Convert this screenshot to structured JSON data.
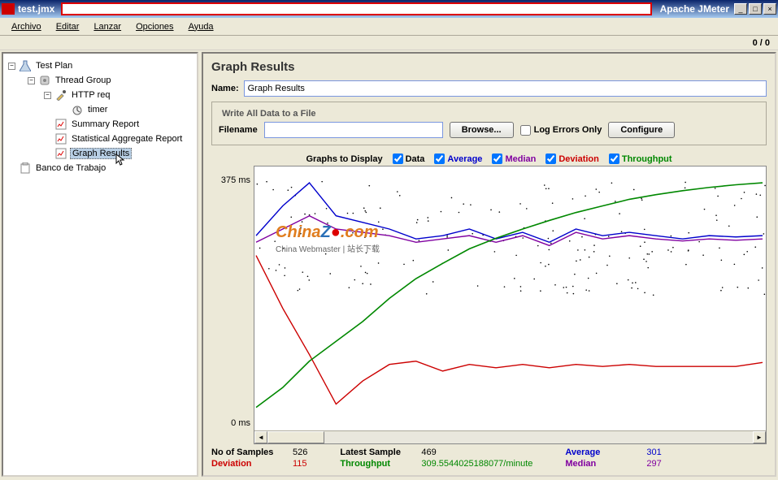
{
  "title": {
    "filename": "test.jmx",
    "app": "Apache JMeter"
  },
  "menu": {
    "archivo": "Archivo",
    "editar": "Editar",
    "lanzar": "Lanzar",
    "opciones": "Opciones",
    "ayuda": "Ayuda"
  },
  "counter": "0 / 0",
  "tree": {
    "testplan": "Test Plan",
    "threadgroup": "Thread Group",
    "httpreq": "HTTP req",
    "timer": "timer",
    "summary": "Summary Report",
    "aggregate": "Statistical Aggregate Report",
    "graph": "Graph Results",
    "workbench": "Banco de Trabajo"
  },
  "panel": {
    "heading": "Graph Results",
    "name_label": "Name:",
    "name_value": "Graph Results",
    "fieldset_title": "Write All Data to a File",
    "filename_label": "Filename",
    "filename_value": "",
    "browse": "Browse...",
    "log_errors": "Log Errors Only",
    "configure": "Configure",
    "graphs_label": "Graphs to Display",
    "opt_data": "Data",
    "opt_average": "Average",
    "opt_median": "Median",
    "opt_deviation": "Deviation",
    "opt_throughput": "Throughput"
  },
  "yaxis": {
    "top": "375 ms",
    "bottom": "0 ms"
  },
  "watermark": {
    "line1a": "China",
    "line1b": "Z",
    "line1c": ".com",
    "line2": "China Webmaster | 站长下载"
  },
  "stats": {
    "samples_label": "No of Samples",
    "samples": "526",
    "deviation_label": "Deviation",
    "deviation": "115",
    "latest_label": "Latest Sample",
    "latest": "469",
    "throughput_label": "Throughput",
    "throughput": "309.5544025188077/minute",
    "average_label": "Average",
    "average": "301",
    "median_label": "Median",
    "median": "297"
  },
  "chart_data": {
    "type": "line",
    "ylabel": "ms",
    "ylim": [
      0,
      375
    ],
    "x_samples": 526,
    "series": [
      {
        "name": "Average",
        "color": "#0000cc",
        "values": [
          290,
          335,
          370,
          320,
          310,
          300,
          285,
          290,
          300,
          285,
          295,
          280,
          300,
          290,
          295,
          290,
          285,
          290,
          288,
          290
        ]
      },
      {
        "name": "Median",
        "color": "#8000a0",
        "values": [
          280,
          300,
          320,
          300,
          295,
          290,
          280,
          285,
          290,
          280,
          290,
          275,
          295,
          285,
          290,
          285,
          282,
          285,
          283,
          285
        ]
      },
      {
        "name": "Deviation",
        "color": "#cc0000",
        "values": [
          260,
          180,
          110,
          35,
          70,
          95,
          100,
          85,
          95,
          90,
          95,
          90,
          95,
          92,
          95,
          92,
          92,
          92,
          92,
          98
        ]
      },
      {
        "name": "Throughput",
        "color": "#008800",
        "values": [
          30,
          60,
          100,
          130,
          160,
          195,
          225,
          248,
          270,
          286,
          300,
          313,
          325,
          335,
          345,
          352,
          358,
          363,
          367,
          370
        ]
      }
    ],
    "scatter": {
      "name": "Data",
      "color": "#000",
      "approx_points": 500,
      "y_range": [
        200,
        375
      ]
    }
  }
}
